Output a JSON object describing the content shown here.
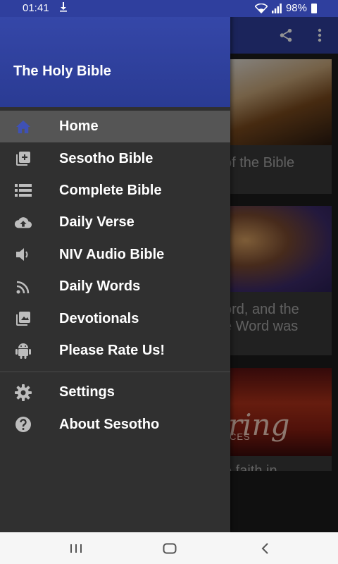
{
  "status_bar": {
    "time": "01:41",
    "battery": "98%"
  },
  "drawer": {
    "title": "The Holy Bible",
    "items": [
      {
        "label": "Home",
        "icon": "home-icon",
        "active": true
      },
      {
        "label": "Sesotho Bible",
        "icon": "library-add-icon"
      },
      {
        "label": "Complete Bible",
        "icon": "list-icon"
      },
      {
        "label": "Daily Verse",
        "icon": "cloud-upload-icon"
      },
      {
        "label": "NIV Audio Bible",
        "icon": "volume-icon"
      },
      {
        "label": "Daily Words",
        "icon": "rss-feed-icon"
      },
      {
        "label": "Devotionals",
        "icon": "collections-icon"
      },
      {
        "label": "Please Rate Us!",
        "icon": "android-icon"
      }
    ],
    "secondary_items": [
      {
        "label": "Settings",
        "icon": "gear-icon"
      },
      {
        "label": "About Sesotho",
        "icon": "help-icon"
      }
    ]
  },
  "background": {
    "cards": [
      {
        "text": "of the Bible"
      },
      {
        "text_line1": "ord, and the",
        "text_line2": "e Word was",
        "image_text": ""
      },
      {
        "image_text": "ring",
        "image_subtext": "CES",
        "text": "e faith in"
      }
    ]
  },
  "colors": {
    "primary": "#2f3f9e",
    "drawer_bg": "#303030",
    "active_item": "#555555",
    "icon": "#bdbdbd",
    "active_icon": "#3f51b5"
  }
}
